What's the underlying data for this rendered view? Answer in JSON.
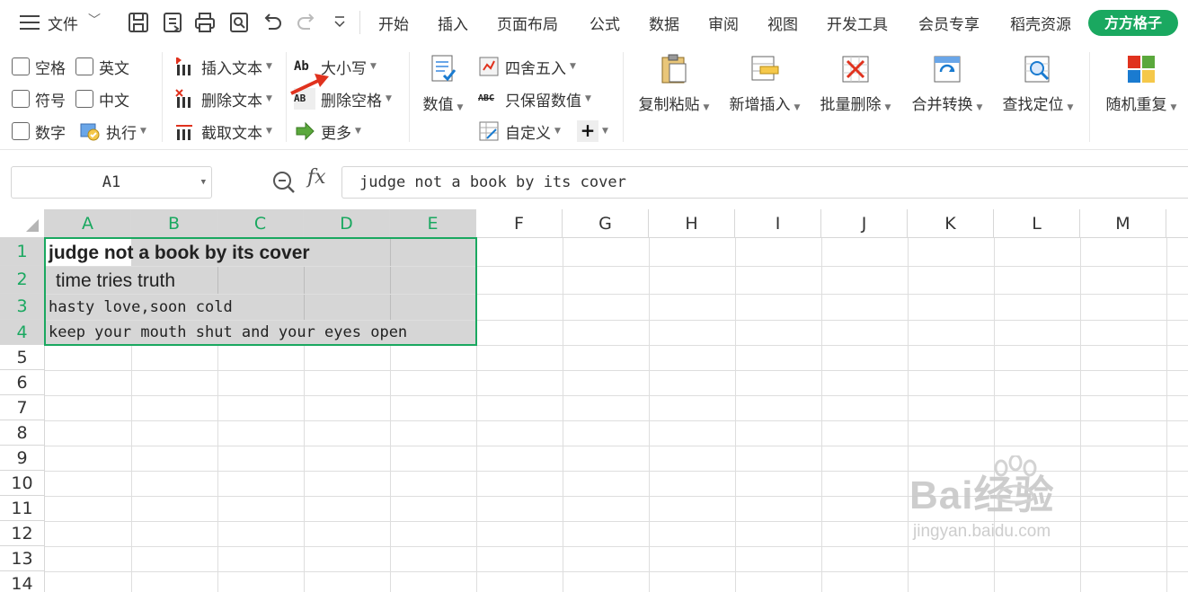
{
  "menubar": {
    "file_label": "文件",
    "tabs": [
      "开始",
      "插入",
      "页面布局",
      "公式",
      "数据",
      "审阅",
      "视图",
      "开发工具",
      "会员专享",
      "稻壳资源"
    ],
    "member_tab": "方方格子"
  },
  "ribbon": {
    "checks": {
      "kongge": "空格",
      "yingwen": "英文",
      "fuhao": "符号",
      "zhongwen": "中文",
      "shuzi": "数字",
      "zhixing": "执行"
    },
    "text_ops": {
      "insert": "插入文本",
      "delete": "删除文本",
      "extract": "截取文本"
    },
    "case_ops": {
      "case": "大小写",
      "del_space": "删除空格",
      "more": "更多"
    },
    "num_ops": {
      "value": "数值",
      "round": "四舍五入",
      "keep_num": "只保留数值",
      "custom": "自定义",
      "plus": "+"
    },
    "big_buttons": {
      "copy_paste": "复制粘贴",
      "add_insert": "新增插入",
      "batch_delete": "批量删除",
      "merge_convert": "合并转换",
      "find_locate": "查找定位",
      "random_repeat": "随机重复"
    },
    "colors": {
      "accent": "#1aa860",
      "arrow": "#e0321e"
    }
  },
  "formula_bar": {
    "name_box": "A1",
    "fx": "fx",
    "content": "judge not a book by its cover"
  },
  "sheet": {
    "columns": [
      "A",
      "B",
      "C",
      "D",
      "E",
      "F",
      "G",
      "H",
      "I",
      "J",
      "K",
      "L",
      "M"
    ],
    "rows": [
      "1",
      "2",
      "3",
      "4",
      "5",
      "6",
      "7",
      "8",
      "9",
      "10",
      "11",
      "12",
      "13",
      "14"
    ],
    "cells": {
      "A1": "judge not a book by its cover",
      "A2": " time tries truth",
      "A3": "hasty love,soon cold",
      "A4": "keep your mouth shut and your eyes open"
    },
    "selection": "A1:E4"
  },
  "watermark": {
    "main": "Bai经验",
    "sub": "jingyan.baidu.com"
  }
}
